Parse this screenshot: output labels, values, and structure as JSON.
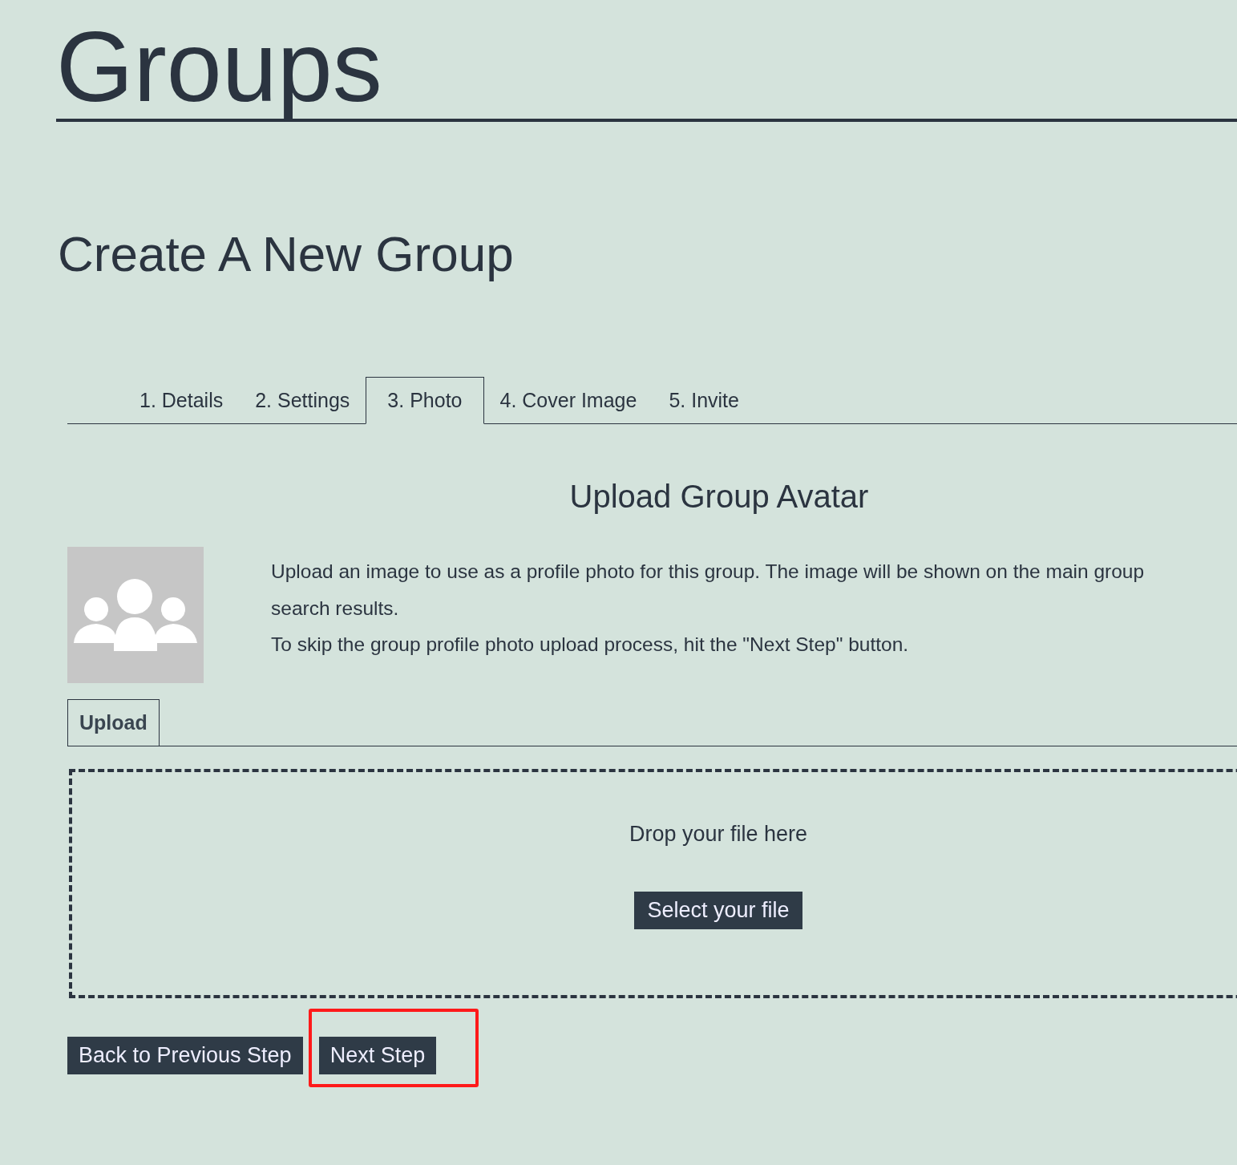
{
  "site_title": "Groups",
  "page_title": "Create A New Group",
  "tabs": [
    {
      "label": "1. Details",
      "selected": false
    },
    {
      "label": "2. Settings",
      "selected": false
    },
    {
      "label": "3. Photo",
      "selected": true
    },
    {
      "label": "4. Cover Image",
      "selected": false
    },
    {
      "label": "5. Invite",
      "selected": false
    }
  ],
  "section_title": "Upload Group Avatar",
  "description": [
    "Upload an image to use as a profile photo for this group. The image will be shown on the main group",
    "search results.",
    "To skip the group profile photo upload process, hit the \"Next Step\" button."
  ],
  "upload_tabs": [
    {
      "label": "Upload",
      "selected": true
    }
  ],
  "dropzone": {
    "text": "Drop your file here",
    "button": "Select your file"
  },
  "buttons": [
    {
      "label": "Back to Previous Step",
      "highlighted": false
    },
    {
      "label": "Next Step",
      "highlighted": true
    }
  ]
}
